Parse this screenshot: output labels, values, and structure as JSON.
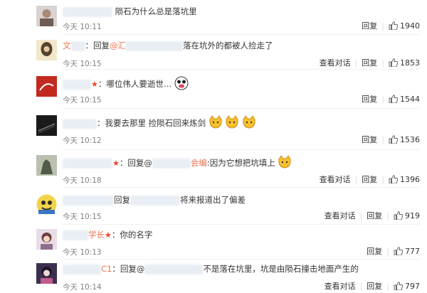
{
  "comments": [
    {
      "text": "陨石为什么总是落坑里",
      "time": "今天 10:11",
      "reply": "回复",
      "likes": "1940",
      "show_conversation": ""
    },
    {
      "user_prefix": "文",
      "reply_prefix": "：回复",
      "mention": "@汇",
      "text": "落在坑外的都被人捡走了",
      "time": "今天 10:15",
      "conversation": "查看对话",
      "reply": "回复",
      "likes": "1853"
    },
    {
      "text": "：哪位伟人要逝世…",
      "time": "今天 10:15",
      "reply": "回复",
      "likes": "1544"
    },
    {
      "text": "：我要去那里 捡陨石回来炼剑",
      "time": "今天 10:12",
      "reply": "回复",
      "likes": "1536"
    },
    {
      "reply_prefix": "：回复@",
      "mention_suffix": "会编",
      "text": ":因为它想把坑填上",
      "time": "今天 10:18",
      "conversation": "查看对话",
      "reply": "回复",
      "likes": "1396"
    },
    {
      "reply_prefix": "回复",
      "text": "将来报道出了偏差",
      "time": "今天 10:15",
      "conversation": "查看对话",
      "reply": "回复",
      "likes": "919"
    },
    {
      "user_suffix": "学长",
      "text": "：你的名字",
      "time": "今天 10:13",
      "reply": "回复",
      "likes": "777"
    },
    {
      "user_suffix": "C1",
      "reply_prefix": "：回复@",
      "text": "不是落在坑里，坑是由陨石撞击地面产生的",
      "time": "今天 10:14",
      "conversation": "查看对话",
      "reply": "回复",
      "likes": "797"
    }
  ],
  "colors": {
    "username": "#eb7350",
    "meta": "#808080",
    "vip_star": "#ef4125"
  }
}
